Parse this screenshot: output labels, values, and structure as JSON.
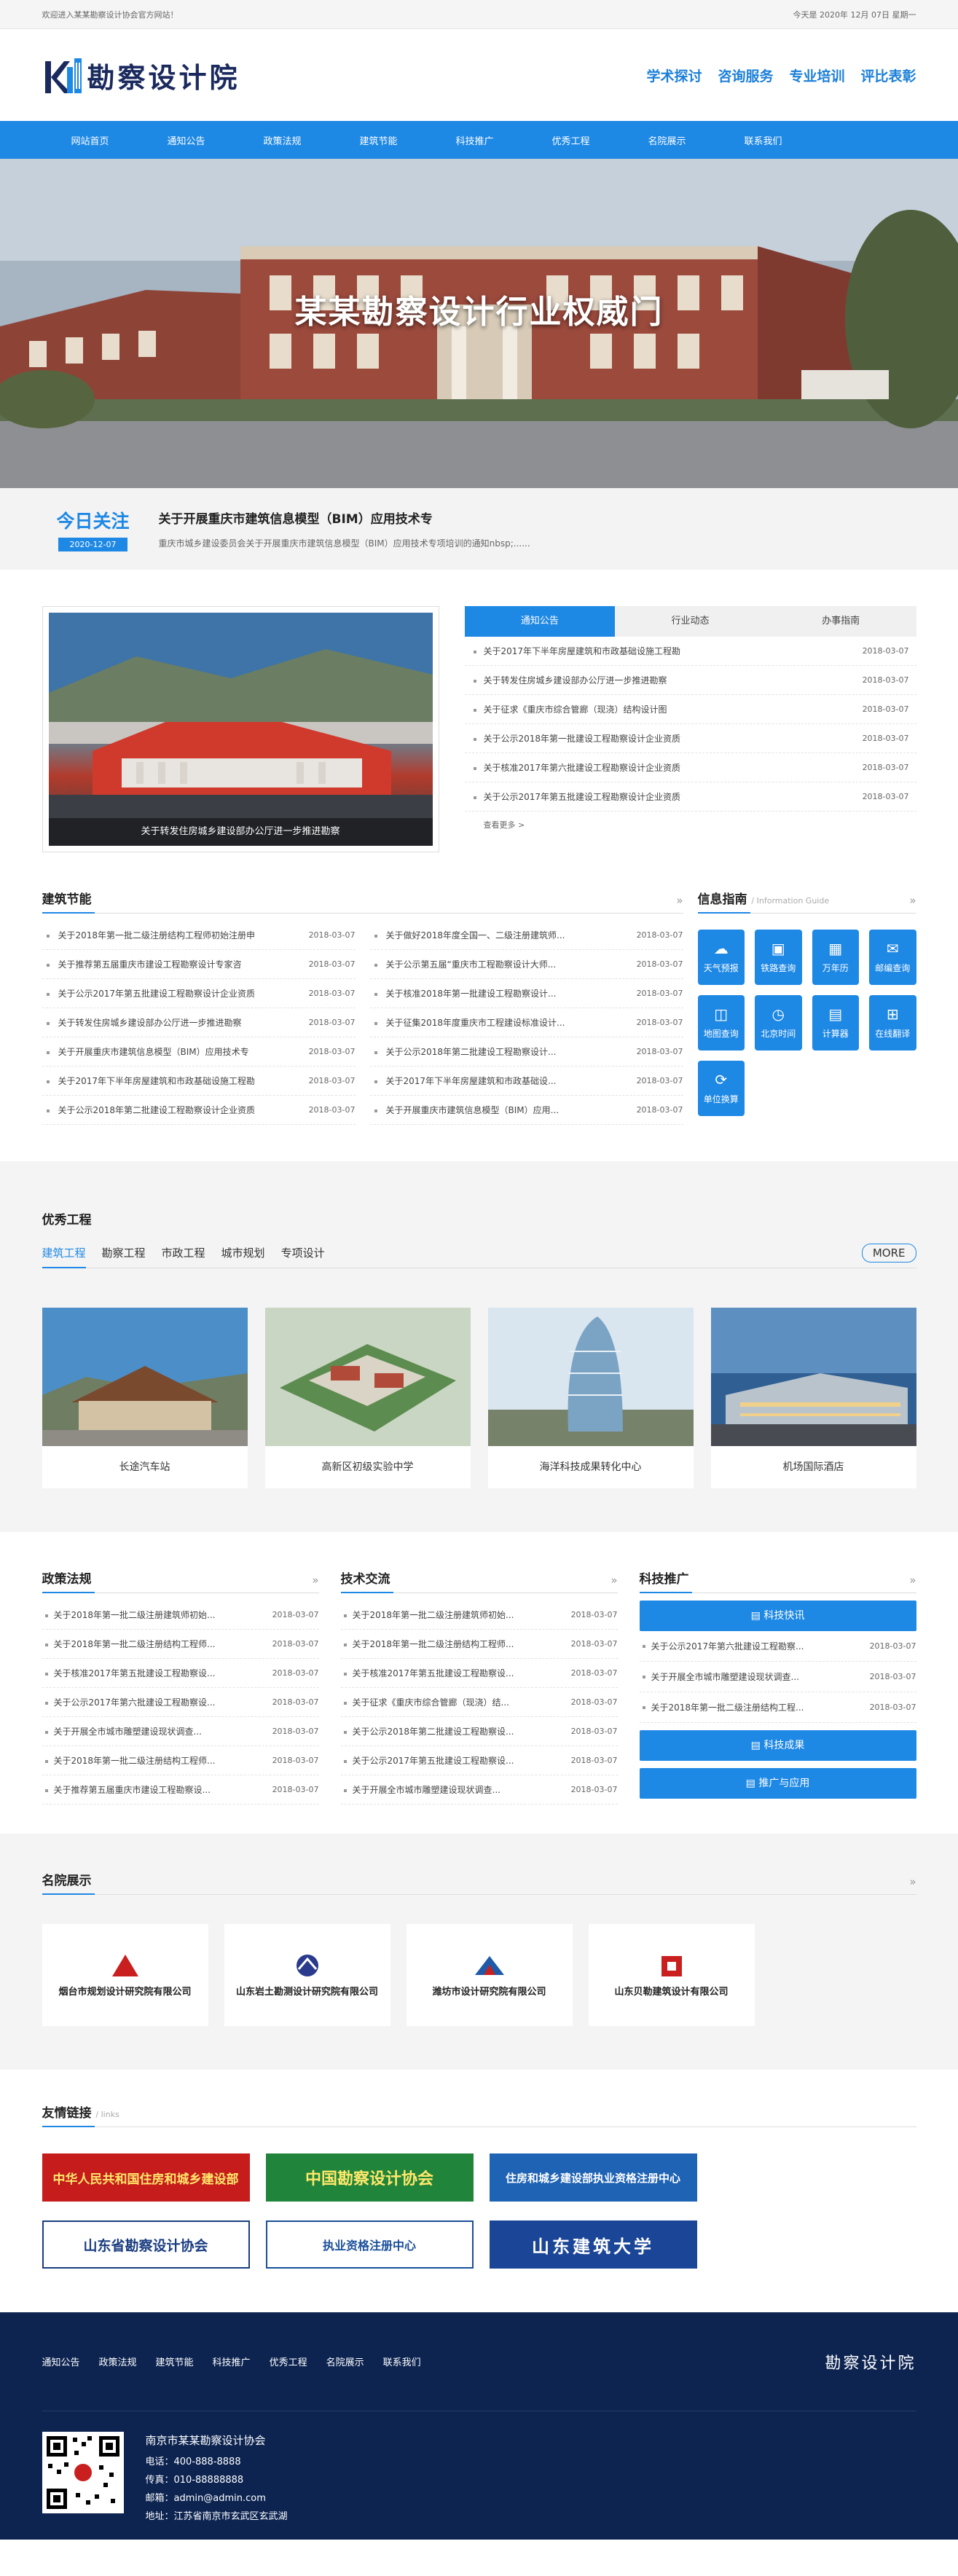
{
  "topbar": {
    "welcome": "欢迎进入某某勘察设计协会官方网站！",
    "date": "今天是 2020年 12月 07日 星期一"
  },
  "header": {
    "logo_text": "勘察设计院",
    "links": [
      "学术探讨",
      "咨询服务",
      "专业培训",
      "评比表彰"
    ]
  },
  "nav": [
    "网站首页",
    "通知公告",
    "政策法规",
    "建筑节能",
    "科技推广",
    "优秀工程",
    "名院展示",
    "联系我们"
  ],
  "banner": {
    "title": "某某勘察设计行业权威门"
  },
  "today": {
    "label": "今日关注",
    "date": "2020-12-07",
    "headline": "关于开展重庆市建筑信息模型（BIM）应用技术专",
    "summary": "重庆市城乡建设委员会关于开展重庆市建筑信息模型（BIM）应用技术专项培训的通知nbsp;......"
  },
  "news": {
    "caption": "关于转发住房城乡建设部办公厅进一步推进勘察",
    "tabs": [
      "通知公告",
      "行业动态",
      "办事指南"
    ],
    "items": [
      {
        "title": "关于2017年下半年房屋建筑和市政基础设施工程勘",
        "date": "2018-03-07"
      },
      {
        "title": "关于转发住房城乡建设部办公厅进一步推进勘察",
        "date": "2018-03-07"
      },
      {
        "title": "关于征求《重庆市综合管廊（现浇）结构设计图",
        "date": "2018-03-07"
      },
      {
        "title": "关于公示2018年第一批建设工程勘察设计企业资质",
        "date": "2018-03-07"
      },
      {
        "title": "关于核准2017年第六批建设工程勘察设计企业资质",
        "date": "2018-03-07"
      },
      {
        "title": "关于公示2017年第五批建设工程勘察设计企业资质",
        "date": "2018-03-07"
      }
    ],
    "more": "查看更多 >"
  },
  "jianzhu": {
    "title": "建筑节能",
    "left": [
      {
        "title": "关于2018年第一批二级注册结构工程师初始注册申",
        "date": "2018-03-07"
      },
      {
        "title": "关于推荐第五届重庆市建设工程勘察设计专家咨",
        "date": "2018-03-07"
      },
      {
        "title": "关于公示2017年第五批建设工程勘察设计企业资质",
        "date": "2018-03-07"
      },
      {
        "title": "关于转发住房城乡建设部办公厅进一步推进勘察",
        "date": "2018-03-07"
      },
      {
        "title": "关于开展重庆市建筑信息模型（BIM）应用技术专",
        "date": "2018-03-07"
      },
      {
        "title": "关于2017年下半年房屋建筑和市政基础设施工程勘",
        "date": "2018-03-07"
      },
      {
        "title": "关于公示2018年第二批建设工程勘察设计企业资质",
        "date": "2018-03-07"
      }
    ],
    "right": [
      {
        "title": "关于做好2018年度全国一、二级注册建筑师...",
        "date": "2018-03-07"
      },
      {
        "title": "关于公示第五届“重庆市工程勘察设计大师...",
        "date": "2018-03-07"
      },
      {
        "title": "关于核准2018年第一批建设工程勘察设计...",
        "date": "2018-03-07"
      },
      {
        "title": "关于征集2018年度重庆市工程建设标准设计...",
        "date": "2018-03-07"
      },
      {
        "title": "关于公示2018年第二批建设工程勘察设计...",
        "date": "2018-03-07"
      },
      {
        "title": "关于2017年下半年房屋建筑和市政基础设...",
        "date": "2018-03-07"
      },
      {
        "title": "关于开展重庆市建筑信息模型（BIM）应用...",
        "date": "2018-03-07"
      }
    ]
  },
  "info": {
    "title": "信息指南",
    "sub": "/ Information Guide",
    "items": [
      {
        "label": "天气预报",
        "icon": "☁"
      },
      {
        "label": "铁路查询",
        "icon": "▣"
      },
      {
        "label": "万年历",
        "icon": "▦"
      },
      {
        "label": "邮编查询",
        "icon": "✉"
      },
      {
        "label": "地图查询",
        "icon": "◫"
      },
      {
        "label": "北京时间",
        "icon": "◷"
      },
      {
        "label": "计算器",
        "icon": "▤"
      },
      {
        "label": "在线翻译",
        "icon": "⊞"
      },
      {
        "label": "单位换算",
        "icon": "⟳"
      }
    ]
  },
  "projects": {
    "title": "优秀工程",
    "tabs": [
      "建筑工程",
      "勘察工程",
      "市政工程",
      "城市规划",
      "专项设计"
    ],
    "more": "MORE",
    "items": [
      "长途汽车站",
      "高新区初级实验中学",
      "海洋科技成果转化中心",
      "机场国际酒店"
    ]
  },
  "policy": {
    "title": "政策法规",
    "items": [
      {
        "title": "关于2018年第一批二级注册建筑师初始...",
        "date": "2018-03-07"
      },
      {
        "title": "关于2018年第一批二级注册结构工程师...",
        "date": "2018-03-07"
      },
      {
        "title": "关于核准2017年第五批建设工程勘察设...",
        "date": "2018-03-07"
      },
      {
        "title": "关于公示2017年第六批建设工程勘察设...",
        "date": "2018-03-07"
      },
      {
        "title": "关于开展全市城市雕塑建设现状调查...",
        "date": "2018-03-07"
      },
      {
        "title": "关于2018年第一批二级注册结构工程师...",
        "date": "2018-03-07"
      },
      {
        "title": "关于推荐第五届重庆市建设工程勘察设...",
        "date": "2018-03-07"
      }
    ]
  },
  "tech": {
    "title": "技术交流",
    "items": [
      {
        "title": "关于2018年第一批二级注册建筑师初始...",
        "date": "2018-03-07"
      },
      {
        "title": "关于2018年第一批二级注册结构工程师...",
        "date": "2018-03-07"
      },
      {
        "title": "关于核准2017年第五批建设工程勘察设...",
        "date": "2018-03-07"
      },
      {
        "title": "关于征求《重庆市综合管廊（现浇）结...",
        "date": "2018-03-07"
      },
      {
        "title": "关于公示2018年第二批建设工程勘察设...",
        "date": "2018-03-07"
      },
      {
        "title": "关于公示2017年第五批建设工程勘察设...",
        "date": "2018-03-07"
      },
      {
        "title": "关于开展全市城市雕塑建设现状调查...",
        "date": "2018-03-07"
      }
    ]
  },
  "promo": {
    "title": "科技推广",
    "btn1": "科技快讯",
    "items": [
      {
        "title": "关于公示2017年第六批建设工程勘察...",
        "date": "2018-03-07"
      },
      {
        "title": "关于开展全市城市雕塑建设现状调查...",
        "date": "2018-03-07"
      },
      {
        "title": "关于2018年第一批二级注册结构工程...",
        "date": "2018-03-07"
      }
    ],
    "btn2": "科技成果",
    "btn3": "推广与应用"
  },
  "famous": {
    "title": "名院展示",
    "items": [
      {
        "name": "烟台市规划设计研究院有限公司",
        "color": "#c9201f"
      },
      {
        "name": "山东岩土勘测设计研究院有限公司",
        "color": "#2a3a8c"
      },
      {
        "name": "潍坊市设计研究院有限公司",
        "color": "#1e5aa8"
      },
      {
        "name": "山东贝勒建筑设计有限公司",
        "color": "#c9201f"
      }
    ]
  },
  "links": {
    "title": "友情链接",
    "sub": "/ links",
    "items": [
      {
        "text": "中华人民共和国住房和城乡建设部",
        "bg": "#c61c1c",
        "fg": "#ffe86b"
      },
      {
        "text": "中国勘察设计协会",
        "bg": "#20843a",
        "fg": "#ffe86b"
      },
      {
        "text": "住房和城乡建设部执业资格注册中心",
        "bg": "#1f63b5",
        "fg": "#ffffff"
      },
      {
        "text": "山东省勘察设计协会",
        "bg": "#ffffff",
        "fg": "#1a3d80"
      },
      {
        "text": "执业资格注册中心",
        "bg": "#ffffff",
        "fg": "#1a4f9a"
      },
      {
        "text": "山东建筑大学",
        "bg": "#1b4597",
        "fg": "#ffffff"
      }
    ]
  },
  "footer": {
    "nav": [
      "通知公告",
      "政策法规",
      "建筑节能",
      "科技推广",
      "优秀工程",
      "名院展示",
      "联系我们"
    ],
    "logo": "勘察设计院",
    "name": "南京市某某勘察设计协会",
    "phone": "电话：400-888-8888",
    "fax": "传真：010-88888888",
    "email": "邮箱：admin@admin.com",
    "address": "地址：江苏省南京市玄武区玄武湖"
  },
  "colors": {
    "primary": "#1e88e5",
    "footer": "#0d2451"
  }
}
